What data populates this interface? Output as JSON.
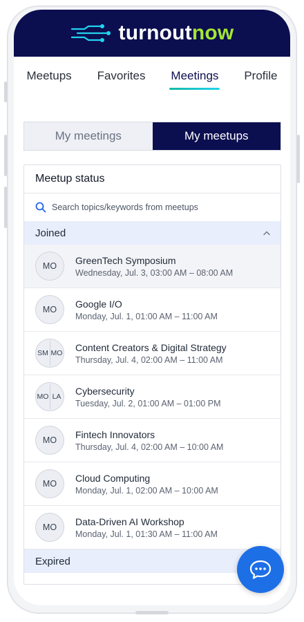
{
  "brand": {
    "turnout": "turnout",
    "now": "now"
  },
  "nav": {
    "items": [
      {
        "label": "Meetups"
      },
      {
        "label": "Favorites"
      },
      {
        "label": "Meetings"
      },
      {
        "label": "Profile"
      }
    ],
    "active": "Meetings"
  },
  "segment": {
    "my_meetings": "My meetings",
    "my_meetups": "My meetups",
    "selected": "My meetups"
  },
  "card": {
    "title": "Meetup status",
    "search_placeholder": "Search topics/keywords from meetups",
    "joined_label": "Joined",
    "expired_label": "Expired",
    "meetups": [
      {
        "avatars": [
          "MO"
        ],
        "title": "GreenTech Symposium",
        "time": "Wednesday, Jul. 3, 03:00 AM – 08:00 AM"
      },
      {
        "avatars": [
          "MO"
        ],
        "title": "Google I/O",
        "time": "Monday, Jul. 1, 01:00 AM – 11:00 AM"
      },
      {
        "avatars": [
          "SM",
          "MO"
        ],
        "title": "Content Creators & Digital Strategy",
        "time": "Thursday, Jul. 4, 02:00 AM – 11:00 AM"
      },
      {
        "avatars": [
          "MO",
          "LA"
        ],
        "title": "Cybersecurity",
        "time": "Tuesday, Jul. 2, 01:00 AM – 01:00 PM"
      },
      {
        "avatars": [
          "MO"
        ],
        "title": "Fintech Innovators",
        "time": "Thursday, Jul. 4, 02:00 AM – 10:00 AM"
      },
      {
        "avatars": [
          "MO"
        ],
        "title": "Cloud Computing",
        "time": "Monday, Jul. 1, 02:00 AM – 10:00 AM"
      },
      {
        "avatars": [
          "MO"
        ],
        "title": "Data-Driven AI Workshop",
        "time": "Monday, Jul. 1, 01:30 AM – 11:00 AM"
      }
    ]
  },
  "icons": {
    "search": "search-icon",
    "chevron": "chevron-up-icon",
    "chat": "chat-bubble-icon",
    "logo": "circuit-logo-icon"
  },
  "colors": {
    "brand_navy": "#0b0e4f",
    "brand_green": "#a3e635",
    "accent_teal": "#14b8a6",
    "fab_blue": "#1d6fe6"
  }
}
